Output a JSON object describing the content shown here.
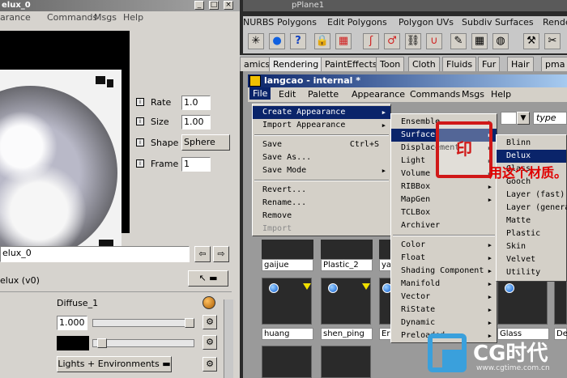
{
  "left_panel": {
    "title": "elux_0",
    "window_buttons": [
      "_",
      "□",
      "×"
    ],
    "menu": [
      "arance",
      "Commands",
      "Msgs",
      "Help"
    ],
    "params": [
      {
        "label": "Rate",
        "value": "1.0"
      },
      {
        "label": "Size",
        "value": "1.00"
      },
      {
        "label": "Shape",
        "value": "Sphere"
      },
      {
        "label": "Frame",
        "value": "1"
      }
    ],
    "shader_name_field": "elux_0",
    "shader_type_label": "elux (v0)",
    "diffuse": {
      "label": "Diffuse_1",
      "value": "1.000"
    },
    "lights_button": "Lights + Environments"
  },
  "right_title": "pPlane1",
  "top_menu": [
    "NURBS",
    "Polygons",
    "Edit Polygons",
    "Polygon UVs",
    "Subdiv Surfaces",
    "Rende"
  ],
  "tabs": [
    "amics",
    "Rendering",
    "PaintEffects",
    "Toon",
    "Cloth",
    "Fluids",
    "Fur",
    "Hair",
    "pma"
  ],
  "hypershade": {
    "title": "langcao - internal *",
    "menu": [
      "File",
      "Edit",
      "Palette",
      "Appearance",
      "Commands",
      "Msgs",
      "Help"
    ],
    "type_label": "type",
    "swatches_row1": [
      "gaijue",
      "Plastic_2",
      "ya"
    ],
    "swatches_row2": [
      "huang",
      "shen_ping",
      "Er",
      "Glass",
      "De"
    ]
  },
  "file_menu": [
    {
      "label": "Create Appearance",
      "submenu": true,
      "highlight": true
    },
    {
      "label": "Import Appearance",
      "submenu": true
    },
    {
      "sep": true
    },
    {
      "label": "Save",
      "shortcut": "Ctrl+S"
    },
    {
      "label": "Save As..."
    },
    {
      "label": "Save Mode",
      "submenu": true
    },
    {
      "sep": true
    },
    {
      "label": "Revert..."
    },
    {
      "label": "Rename..."
    },
    {
      "label": "Remove"
    },
    {
      "label": "Import",
      "disabled": true
    }
  ],
  "create_menu": [
    {
      "label": "Ensemble",
      "submenu": true
    },
    {
      "label": "Surface",
      "submenu": true,
      "highlight": true
    },
    {
      "label": "Displacement",
      "submenu": true
    },
    {
      "label": "Light",
      "submenu": true
    },
    {
      "label": "Volume",
      "submenu": true
    },
    {
      "label": "RIBBox",
      "submenu": true
    },
    {
      "label": "MapGen",
      "submenu": true
    },
    {
      "label": "TCLBox"
    },
    {
      "label": "Archiver"
    },
    {
      "sep": true
    },
    {
      "label": "Color",
      "submenu": true
    },
    {
      "label": "Float",
      "submenu": true
    },
    {
      "label": "Shading Component",
      "submenu": true
    },
    {
      "label": "Manifold",
      "submenu": true
    },
    {
      "label": "Vector",
      "submenu": true
    },
    {
      "label": "RiState",
      "submenu": true
    },
    {
      "label": "Dynamic",
      "submenu": true
    },
    {
      "label": "Preloaded",
      "submenu": true
    }
  ],
  "surface_menu": [
    {
      "label": "Blinn"
    },
    {
      "label": "Delux",
      "highlight": true
    },
    {
      "label": "Glass"
    },
    {
      "label": "Gooch"
    },
    {
      "label": "Layer (fast)"
    },
    {
      "label": "Layer (general)"
    },
    {
      "label": "Matte"
    },
    {
      "label": "Plastic"
    },
    {
      "label": "Skin"
    },
    {
      "label": "Velvet"
    },
    {
      "label": "Utility"
    }
  ],
  "watermark": {
    "stamp": "印",
    "text": "用这个材质。"
  },
  "logo": {
    "brand": "CG时代",
    "url": "www.cgtime.com.cn"
  }
}
